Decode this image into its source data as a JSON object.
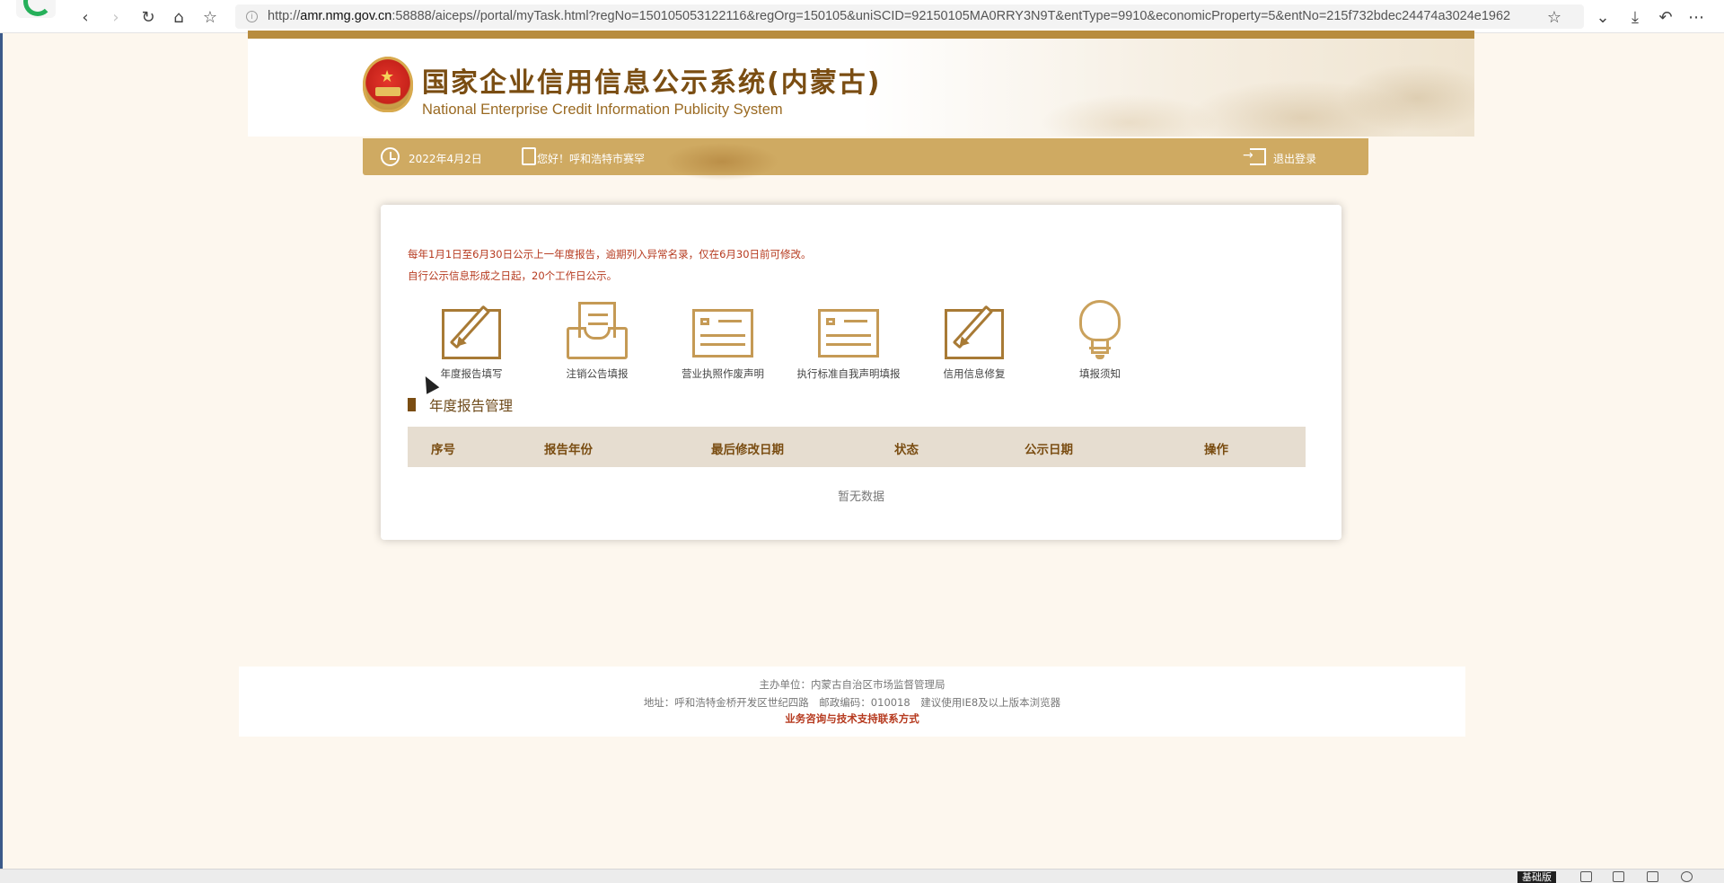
{
  "browser": {
    "url_prefix": "http://",
    "url_host": "amr.nmg.gov.cn",
    "url_rest": ":58888/aiceps//portal/myTask.html?regNo=150105053122116&regOrg=150105&uniSCID=92150105MA0RRY3N9T&entType=9910&economicProperty=5&entNo=215f732bdec24474a3024e1962",
    "info_glyph": "i"
  },
  "header": {
    "title": "国家企业信用信息公示系统(内蒙古)",
    "subtitle": "National Enterprise Credit Information Publicity System"
  },
  "info_bar": {
    "date": "2022年4月2日",
    "greeting": "您好！呼和浩特市赛罕",
    "logout": "退出登录"
  },
  "notices": {
    "line1": "每年1月1日至6月30日公示上一年度报告，逾期列入异常名录，仅在6月30日前可修改。",
    "line2": "自行公示信息形成之日起，20个工作日公示。"
  },
  "tools": [
    {
      "label": "年度报告填写",
      "icon": "edit-icon"
    },
    {
      "label": "注销公告填报",
      "icon": "tray-icon"
    },
    {
      "label": "营业执照作废声明",
      "icon": "license-icon"
    },
    {
      "label": "执行标准自我声明填报",
      "icon": "license-icon"
    },
    {
      "label": "信用信息修复",
      "icon": "edit-icon"
    },
    {
      "label": "填报须知",
      "icon": "bulb-icon"
    }
  ],
  "section": {
    "title": "年度报告管理"
  },
  "table": {
    "columns": [
      "序号",
      "报告年份",
      "最后修改日期",
      "状态",
      "公示日期",
      "操作"
    ],
    "rows": [],
    "empty_text": "暂无数据"
  },
  "footer": {
    "host": "主办单位：内蒙古自治区市场监督管理局",
    "address": "地址：呼和浩特金桥开发区世纪四路　邮政编码：010018　建议使用IE8及以上版本浏览器",
    "contact": "业务咨询与技术支持联系方式"
  },
  "taskbar": {
    "ime_label": "基础版"
  },
  "colors": {
    "gold": "#cfaa62",
    "brown": "#7a4d12",
    "notice_red": "#b63a1f",
    "page_bg": "#fdf7ee"
  }
}
